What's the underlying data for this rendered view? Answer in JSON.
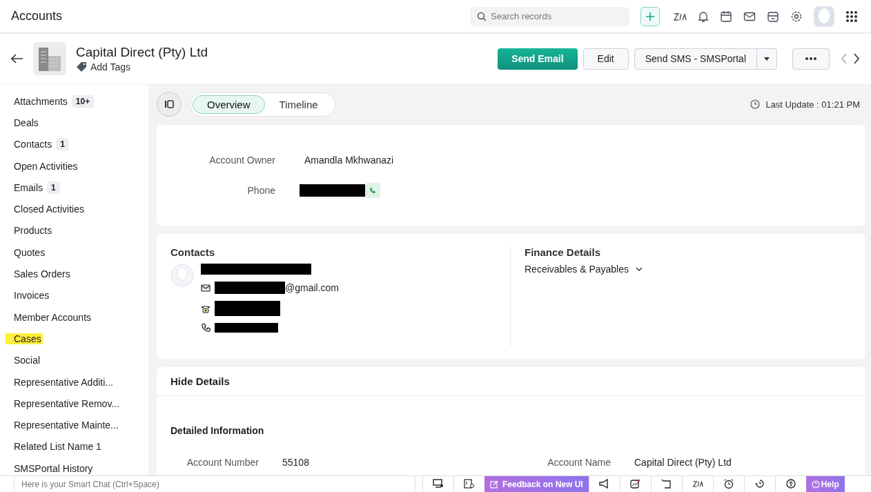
{
  "app": {
    "title": "Accounts",
    "search": {
      "placeholder": "Search records"
    }
  },
  "record": {
    "name": "Capital Direct (Pty) Ltd",
    "add_tags": "Add Tags"
  },
  "actions": {
    "send_email": "Send Email",
    "edit": "Edit",
    "send_sms": "Send SMS - SMSPortal"
  },
  "sidebar": {
    "items": [
      {
        "label": "Attachments",
        "count": "10+",
        "highlighted": false
      },
      {
        "label": "Deals",
        "highlighted": false
      },
      {
        "label": "Contacts",
        "count": "1",
        "highlighted": false
      },
      {
        "label": "Open Activities",
        "highlighted": false
      },
      {
        "label": "Emails",
        "count": "1",
        "highlighted": false
      },
      {
        "label": "Closed Activities",
        "highlighted": false
      },
      {
        "label": "Products",
        "highlighted": false
      },
      {
        "label": "Quotes",
        "highlighted": false
      },
      {
        "label": "Sales Orders",
        "highlighted": false
      },
      {
        "label": "Invoices",
        "highlighted": false
      },
      {
        "label": "Member Accounts",
        "highlighted": false
      },
      {
        "label": "Cases",
        "highlighted": true
      },
      {
        "label": "Social",
        "highlighted": false
      },
      {
        "label": "Representative Additi...",
        "highlighted": false
      },
      {
        "label": "Representative Remov...",
        "highlighted": false
      },
      {
        "label": "Representative Mainte...",
        "highlighted": false
      },
      {
        "label": "Related List Name 1",
        "highlighted": false
      },
      {
        "label": "SMSPortal History",
        "highlighted": false
      }
    ]
  },
  "tabs": [
    {
      "label": "Overview",
      "selected": true
    },
    {
      "label": "Timeline",
      "selected": false
    }
  ],
  "last_update": "Last Update : 01:21 PM",
  "summary": {
    "fields": [
      {
        "label": "Account Owner",
        "value": "Amandla Mkhwanazi"
      },
      {
        "label": "Phone",
        "redacted": true
      }
    ]
  },
  "contacts": {
    "title": "Contacts",
    "email_suffix": "@gmail.com"
  },
  "finance": {
    "title": "Finance Details",
    "dropdown": "Receivables & Payables"
  },
  "details": {
    "toggle": "Hide Details",
    "section": "Detailed Information",
    "fields": [
      {
        "label": "Account Number",
        "value": "55108"
      },
      {
        "label": "Account Name",
        "value": "Capital Direct (Pty) Ltd"
      }
    ]
  },
  "smart_chat": {
    "placeholder": "Here is your Smart Chat (Ctrl+Space)"
  },
  "footer": {
    "feedback": "Feedback on New UI",
    "help": "Help"
  }
}
